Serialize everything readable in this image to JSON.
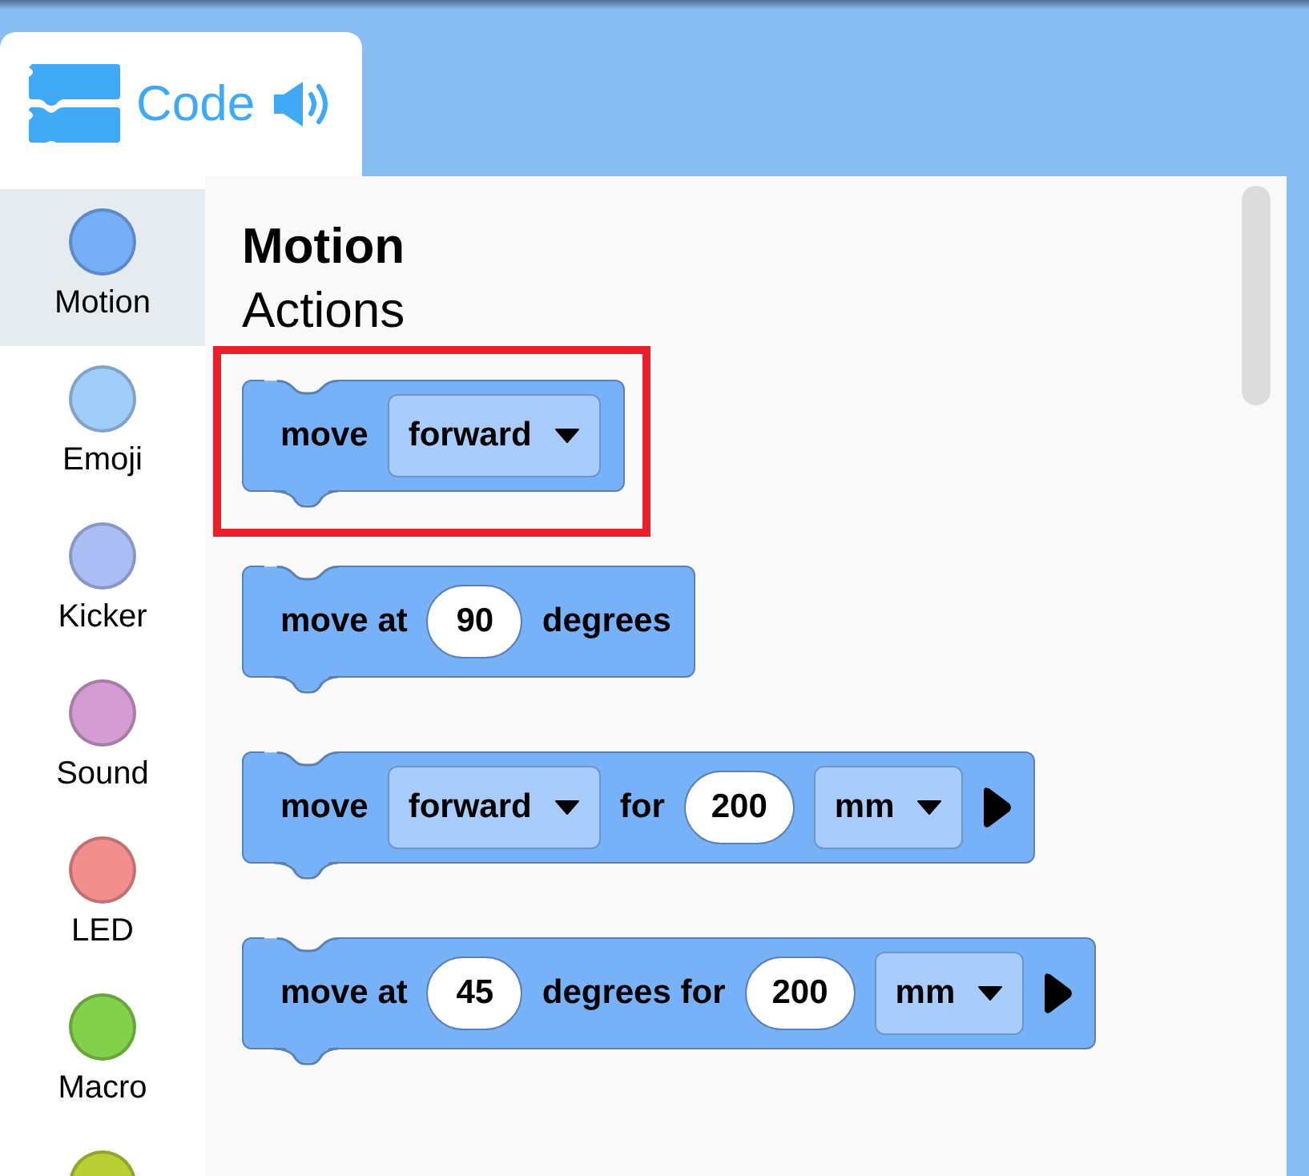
{
  "header": {
    "tab_label": "Code"
  },
  "categories": [
    {
      "label": "Motion",
      "color": "#76aef8",
      "selected": true
    },
    {
      "label": "Emoji",
      "color": "#a0cdfa",
      "selected": false
    },
    {
      "label": "Kicker",
      "color": "#aabdf5",
      "selected": false
    },
    {
      "label": "Sound",
      "color": "#d49cd2",
      "selected": false
    },
    {
      "label": "LED",
      "color": "#f28e8e",
      "selected": false
    },
    {
      "label": "Macro",
      "color": "#82d04c",
      "selected": false
    },
    {
      "color": "#b9d034",
      "selected": false
    }
  ],
  "flyout": {
    "title": "Motion",
    "subtitle": "Actions",
    "blocks": [
      {
        "highlighted": true,
        "parts": [
          {
            "kind": "text",
            "text": "move"
          },
          {
            "kind": "dropdown",
            "text": "forward"
          }
        ]
      },
      {
        "highlighted": false,
        "parts": [
          {
            "kind": "text",
            "text": "move at"
          },
          {
            "kind": "number",
            "text": "90"
          },
          {
            "kind": "text",
            "text": "degrees"
          }
        ]
      },
      {
        "highlighted": false,
        "parts": [
          {
            "kind": "text",
            "text": "move"
          },
          {
            "kind": "dropdown",
            "text": "forward"
          },
          {
            "kind": "text",
            "text": "for"
          },
          {
            "kind": "number",
            "text": "200"
          },
          {
            "kind": "dropdown",
            "text": "mm"
          },
          {
            "kind": "expand"
          }
        ]
      },
      {
        "highlighted": false,
        "parts": [
          {
            "kind": "text",
            "text": "move at"
          },
          {
            "kind": "number",
            "text": "45"
          },
          {
            "kind": "text",
            "text": "degrees for"
          },
          {
            "kind": "number",
            "text": "200"
          },
          {
            "kind": "dropdown",
            "text": "mm"
          },
          {
            "kind": "expand"
          }
        ]
      }
    ]
  }
}
